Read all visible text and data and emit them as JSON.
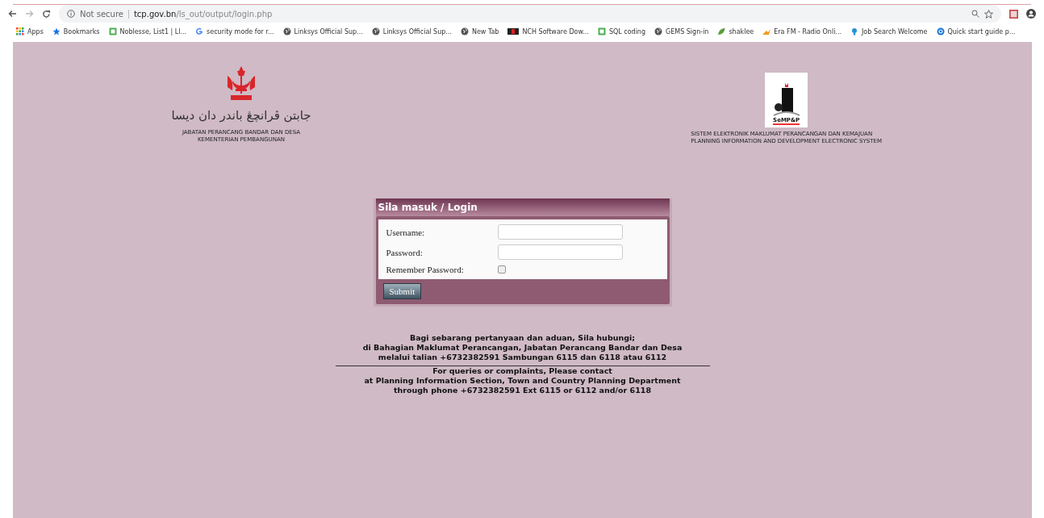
{
  "browser": {
    "security": "Not secure",
    "url_host": "tcp.gov.bn",
    "url_path": "/ls_out/output/login.php",
    "bookmarks": [
      {
        "label": "Apps",
        "kind": "apps"
      },
      {
        "label": "Bookmarks",
        "kind": "star"
      },
      {
        "label": "Noblesse, List1 | Ll...",
        "kind": "sheet"
      },
      {
        "label": "security mode for r...",
        "kind": "google"
      },
      {
        "label": "Linksys Official Sup...",
        "kind": "globe"
      },
      {
        "label": "Linksys Official Sup...",
        "kind": "globe"
      },
      {
        "label": "New Tab",
        "kind": "globe"
      },
      {
        "label": "NCH Software Dow...",
        "kind": "nch"
      },
      {
        "label": "SQL coding",
        "kind": "sheet"
      },
      {
        "label": "GEMS Sign-in",
        "kind": "globe"
      },
      {
        "label": "shaklee",
        "kind": "leaf"
      },
      {
        "label": "Era FM - Radio Onli...",
        "kind": "fm"
      },
      {
        "label": "Job Search Welcome",
        "kind": "bulb"
      },
      {
        "label": "Quick start guide p...",
        "kind": "sync"
      }
    ]
  },
  "header_left": {
    "jawi": "جابتن ڤرانچڠ باندر دان ديسا",
    "lines": [
      "JABATAN PERANCANG BANDAR DAN DESA",
      "KEMENTERIAN PEMBANGUNAN"
    ]
  },
  "header_right": {
    "logo_text": "SeMP&P",
    "lines": [
      "SISTEM ELEKTRONIK MAKLUMAT PERANCANGAN DAN KEMAJUAN",
      "PLANNING INFORMATION AND DEVELOPMENT ELECTRONIC SYSTEM"
    ]
  },
  "login": {
    "title": "Sila masuk / Login",
    "fields": [
      {
        "label": "Username:",
        "kind": "text"
      },
      {
        "label": "Password:",
        "kind": "password"
      },
      {
        "label": "Remember Password:",
        "kind": "checkbox",
        "checked": false
      }
    ],
    "submit": "Submit"
  },
  "contact_malay": [
    "Bagi sebarang pertanyaan dan aduan, Sila hubungi;",
    "di Bahagian Maklumat Perancangan, Jabatan Perancang Bandar dan Desa",
    "melalui talian +6732382591 Sambungan 6115 dan 6118 atau 6112"
  ],
  "contact_english": [
    "For queries or complaints, Please contact",
    "at Planning Information Section, Town and Country Planning Department",
    "through phone +6732382591 Ext 6115 or 6112 and/or 6118"
  ]
}
